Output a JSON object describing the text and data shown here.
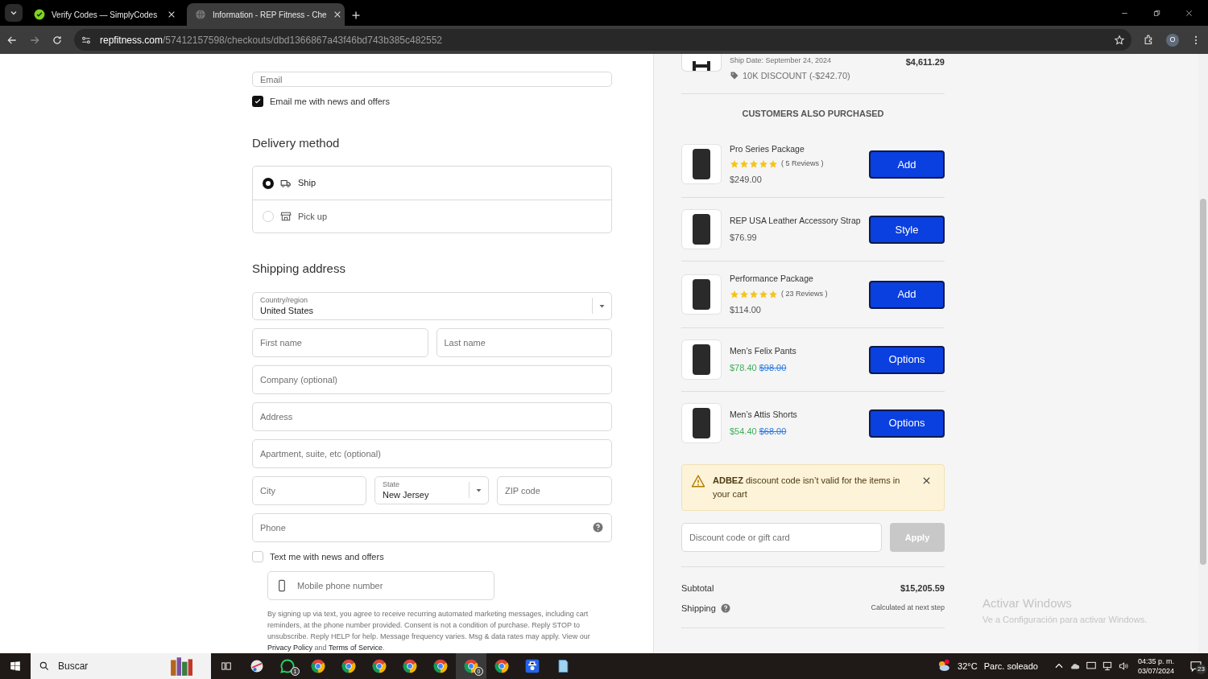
{
  "browser": {
    "tabs": [
      {
        "title": "Verify Codes — SimplyCodes",
        "selected": false
      },
      {
        "title": "Information - REP Fitness - Che",
        "selected": true
      }
    ],
    "url": {
      "host": "repfitness.com",
      "path": "/57412157598/checkouts/dbd1366867a43f46bd743b385c482552"
    },
    "profile_initial": "O"
  },
  "contact": {
    "email_placeholder": "Email",
    "news": {
      "label": "Email me with news and offers",
      "checked": true
    }
  },
  "delivery": {
    "title": "Delivery method",
    "options": [
      {
        "kind": "ship",
        "label": "Ship",
        "selected": true
      },
      {
        "kind": "pickup",
        "label": "Pick up",
        "selected": false
      }
    ]
  },
  "shipping": {
    "title": "Shipping address",
    "rows": [
      [
        {
          "kind": "select",
          "label": "Country/region",
          "value": "United States"
        }
      ],
      [
        {
          "kind": "text",
          "placeholder": "First name"
        },
        {
          "kind": "text",
          "placeholder": "Last name"
        }
      ],
      [
        {
          "kind": "text",
          "placeholder": "Company (optional)"
        }
      ],
      [
        {
          "kind": "text",
          "placeholder": "Address"
        }
      ],
      [
        {
          "kind": "text",
          "placeholder": "Apartment, suite, etc (optional)"
        }
      ],
      [
        {
          "kind": "text",
          "placeholder": "City"
        },
        {
          "kind": "select",
          "label": "State",
          "value": "New Jersey"
        },
        {
          "kind": "text",
          "placeholder": "ZIP code"
        }
      ],
      [
        {
          "kind": "help",
          "placeholder": "Phone"
        }
      ]
    ],
    "sms": {
      "label": "Text me with news and offers",
      "checked": false,
      "mobile_placeholder": "Mobile phone number"
    },
    "disclaimer": "By signing up via text, you agree to receive recurring automated marketing messages, including cart reminders, at the phone number provided. Consent is not a condition of purchase. Reply STOP to unsubscribe. Reply HELP for help. Message frequency varies. Msg & data rates may apply. View our",
    "privacy_link": "Privacy Policy",
    "and": "and",
    "terms_link": "Terms of Service",
    "end": "."
  },
  "summary": {
    "item": {
      "ship_date": "Ship Date: September 24, 2024",
      "discount": "10K DISCOUNT (-$242.70)",
      "price": "$4,611.29"
    },
    "upsell_title": "CUSTOMERS ALSO PURCHASED",
    "products": [
      {
        "name": "Pro Series Package",
        "stars": 5,
        "reviews": "( 5 Reviews )",
        "price": "$249.00",
        "button": "Add"
      },
      {
        "name": "REP USA Leather Accessory Strap",
        "price": "$76.99",
        "button": "Style"
      },
      {
        "name": "Performance Package",
        "stars": 5,
        "reviews": "( 23 Reviews )",
        "price": "$114.00",
        "button": "Add"
      },
      {
        "name": "Men’s Felix Pants",
        "sale_price": "$78.40",
        "original_price": "$98.00",
        "button": "Options"
      },
      {
        "name": "Men’s Attis Shorts",
        "sale_price": "$54.40",
        "original_price": "$68.00",
        "button": "Options"
      }
    ],
    "alert": {
      "message": "**ADBEZ** discount code isn’t valid for the items in your cart"
    },
    "discount": {
      "placeholder": "Discount code or gift card",
      "button": "Apply",
      "disabled": true
    },
    "subtotal": {
      "label": "Subtotal",
      "value": "$15,205.59"
    },
    "shipping": {
      "label": "Shipping",
      "value": "Calculated at next step"
    }
  },
  "activation": {
    "title": "Activar Windows",
    "text": "Ve a Configuración para activar Windows."
  },
  "taskbar": {
    "search": "Buscar",
    "apps": [
      {
        "kind": "snip"
      },
      {
        "kind": "whatsapp",
        "badge": "1"
      },
      {
        "kind": "chrome"
      },
      {
        "kind": "chrome"
      },
      {
        "kind": "chrome"
      },
      {
        "kind": "chrome"
      },
      {
        "kind": "chrome"
      },
      {
        "kind": "chrome",
        "badge": "0",
        "selected": true
      },
      {
        "kind": "chrome"
      },
      {
        "kind": "agent"
      },
      {
        "kind": "notepad"
      }
    ],
    "temperature": "32°C",
    "weather": "Parc. soleado",
    "time": "04:35 p. m.",
    "date": "03/07/2024",
    "notifications": "23"
  }
}
